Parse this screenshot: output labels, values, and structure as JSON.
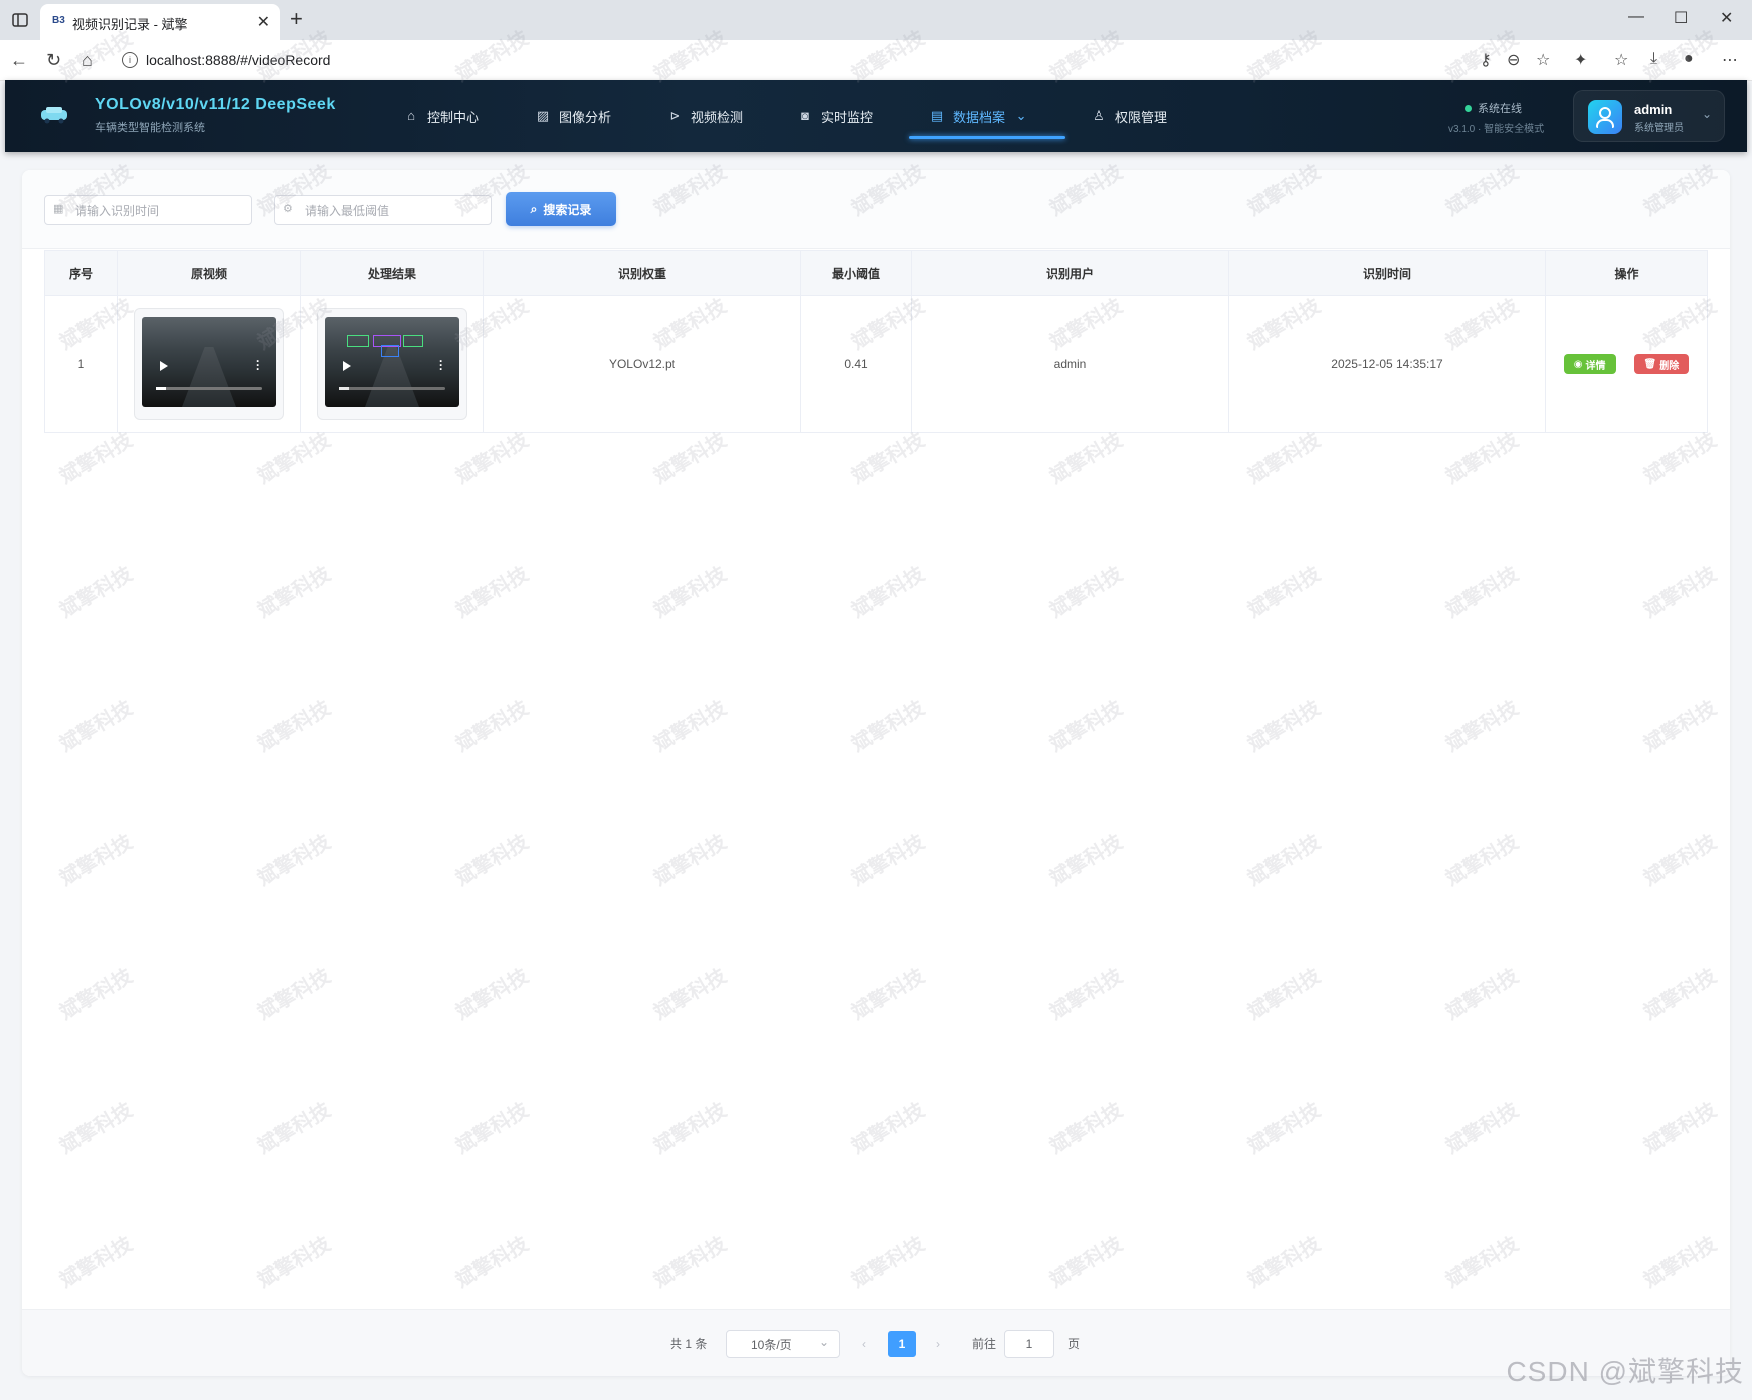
{
  "browser": {
    "tab_title": "视频识别记录 - 斌擎",
    "tab_favicon": "B3",
    "url": "localhost:8888/#/videoRecord"
  },
  "header": {
    "brand_title": "YOLOv8/v10/v11/12 DeepSeek",
    "brand_subtitle": "车辆类型智能检测系统",
    "nav": [
      {
        "label": "控制中心",
        "icon": "home-icon"
      },
      {
        "label": "图像分析",
        "icon": "image-icon"
      },
      {
        "label": "视频检测",
        "icon": "play-circle-icon"
      },
      {
        "label": "实时监控",
        "icon": "camera-icon"
      },
      {
        "label": "数据档案",
        "icon": "document-icon",
        "active": true
      },
      {
        "label": "权限管理",
        "icon": "user-icon"
      }
    ],
    "status": "系统在线",
    "version": "v3.1.0 · 智能安全模式",
    "user": {
      "name": "admin",
      "role": "系统管理员"
    }
  },
  "search": {
    "time_placeholder": "请输入识别时间",
    "threshold_placeholder": "请输入最低阈值",
    "button_label": "搜索记录"
  },
  "table": {
    "headers": [
      "序号",
      "原视频",
      "处理结果",
      "识别权重",
      "最小阈值",
      "识别用户",
      "识别时间",
      "操作"
    ],
    "rows": [
      {
        "index": "1",
        "weight": "YOLOv12.pt",
        "threshold": "0.41",
        "user": "admin",
        "time": "2025-12-05 14:35:17"
      }
    ],
    "detail_label": "详情",
    "delete_label": "删除"
  },
  "pagination": {
    "total": "共 1 条",
    "page_size": "10条/页",
    "current_page": "1",
    "goto_label": "前往",
    "goto_value": "1",
    "page_suffix": "页"
  },
  "watermark": {
    "text": "斌擎科技",
    "credit": "CSDN @斌擎科技"
  },
  "colors": {
    "accent": "#409eff",
    "success": "#67c23a",
    "danger": "#e25c5c",
    "header_bg": "#0d1b2a",
    "brand": "#5fd7f3"
  }
}
